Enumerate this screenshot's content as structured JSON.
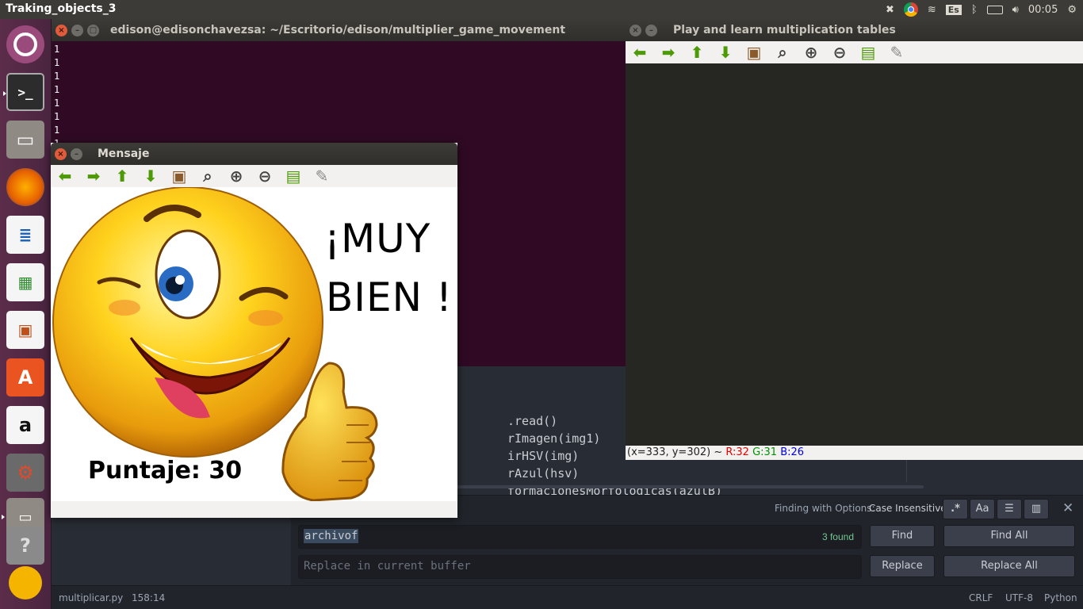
{
  "topbar": {
    "app_title": "Traking_objects_3",
    "keyboard": "Es",
    "clock": "00:05"
  },
  "terminal": {
    "title": "edison@edisonchavezsa: ~/Escritorio/edison/multiplier_game_movement",
    "lines": [
      "1",
      "1",
      "1",
      "1",
      "1",
      "1",
      "1",
      "1"
    ]
  },
  "editor": {
    "code_lines": [
      ".read()",
      "rImagen(img1)",
      "irHSV(img)",
      "rAzul(hsv)",
      "formacionesMorfologicas(azulB)"
    ]
  },
  "find": {
    "options_label": "Finding with Options:",
    "options_value": "Case Insensitive",
    "search_value": "archivof",
    "found_count": "3 found",
    "replace_placeholder": "Replace in current buffer",
    "find_button": "Find",
    "find_all_button": "Find All",
    "replace_button": "Replace",
    "replace_all_button": "Replace All",
    "regex_toggle": ".*",
    "case_toggle": "Aa"
  },
  "statusbar": {
    "file": "multiplicar.py",
    "cursor": "158:14",
    "line_ending": "CRLF",
    "encoding": "UTF-8",
    "grammar": "Python"
  },
  "cv_window": {
    "title": "Play and learn multiplication tables",
    "status_coords": "(x=333, y=302) ~",
    "status_r": "R:32",
    "status_g": "G:31",
    "status_b": "B:26"
  },
  "message_window": {
    "title": "Mensaje",
    "line1": "¡MUY",
    "line2": "BIEN !",
    "score": "Puntaje: 30"
  },
  "colors": {
    "accent_ubuntu": "#dd4814",
    "terminal_bg": "#300a24",
    "editor_bg": "#282c34",
    "found_green": "#73c990"
  }
}
